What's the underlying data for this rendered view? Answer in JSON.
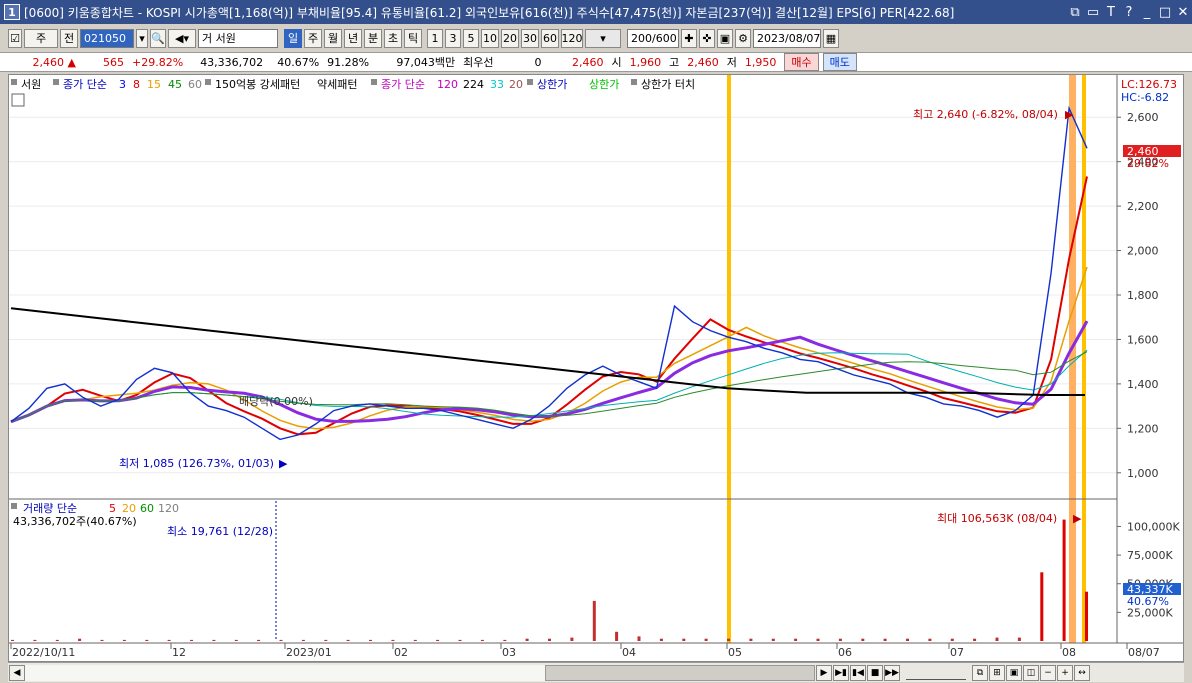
{
  "window": {
    "number": "1",
    "title": "[0600] 키움종합차트 - KOSPI 시가총액[1,168(억)] 부채비율[95.4] 유통비율[61.2] 외국인보유[616(천)] 주식수[47,475(천)] 자본금[237(억)] 결산[12월] EPS[6] PER[422.68]"
  },
  "toolbar": {
    "period_type": "주",
    "market": "전",
    "code": "021050",
    "name_prefix": "거",
    "name": "서원",
    "intervals": [
      "일",
      "주",
      "월",
      "년",
      "분",
      "초",
      "틱"
    ],
    "selected_interval": "일",
    "minutes": [
      "1",
      "3",
      "5",
      "10",
      "20",
      "30",
      "60",
      "120"
    ],
    "count": "200/600",
    "date": "2023/08/07"
  },
  "quote": {
    "price": "2,460",
    "change": "565",
    "change_rate": "+29.82%",
    "volume": "43,336,702",
    "volume_rate": "40.67%",
    "ratio": "91.28%",
    "amount": "97,043백만",
    "preferred_label": "최우선",
    "preferred_value": "0",
    "ask": "2,460",
    "open_label": "시",
    "open": "1,960",
    "high_label": "고",
    "high": "2,460",
    "low_label": "저",
    "low": "1,950",
    "buy_label": "매수",
    "sell_label": "매도"
  },
  "legend": {
    "stock": "서원",
    "ma_label": "종가 단순",
    "ma_periods": [
      "3",
      "8",
      "15",
      "45",
      "60"
    ],
    "ma_colors": [
      "#0000ff",
      "#e00000",
      "#e8a000",
      "#009000",
      "#808080"
    ],
    "pattern1": "150억봉 강세패턴",
    "pattern2": "약세패턴",
    "ma2_label": "종가 단순",
    "ma2_periods": [
      "120",
      "224",
      "33",
      "20"
    ],
    "upper_limit": "상한가",
    "upper_limit2": "상한가",
    "upper_touch": "상한가 터치"
  },
  "chart_data": {
    "type": "line",
    "title": "",
    "price_axis": [
      "2,600",
      "2,400",
      "2,200",
      "2,000",
      "1,800",
      "1,600",
      "1,400",
      "1,200",
      "1,000"
    ],
    "volume_axis": [
      "100,000K",
      "75,000K",
      "50,000K",
      "25,000K"
    ],
    "x_labels": [
      "2022/10/11",
      "12",
      "2023/01",
      "02",
      "03",
      "04",
      "05",
      "06",
      "07",
      "08",
      "08/07"
    ],
    "lc": "LC:126.73",
    "hc": "HC:-6.82",
    "current_price": "2,460",
    "current_rate": "29.82%",
    "current_volume": "43,337K",
    "current_volume_rate": "40.67%",
    "high_annotation": "최고 2,640 (-6.82%, 08/04)",
    "low_annotation": "최저 1,085 (126.73%, 01/03)",
    "dividend_annotation": "배당락(0.00%)",
    "volume_legend": "거래량 단순",
    "volume_ma": [
      "5",
      "20",
      "60",
      "120"
    ],
    "volume_current": "43,336,702주(40.67%)",
    "volume_min": "최소 19,761 (12/28)",
    "volume_max": "최대 106,563K (08/04)",
    "ylim": [
      900,
      2700
    ],
    "close_series": [
      1230,
      1290,
      1380,
      1400,
      1340,
      1300,
      1330,
      1420,
      1470,
      1450,
      1360,
      1300,
      1280,
      1250,
      1200,
      1150,
      1170,
      1220,
      1280,
      1300,
      1310,
      1300,
      1290,
      1290,
      1280,
      1260,
      1240,
      1220,
      1200,
      1240,
      1300,
      1380,
      1440,
      1480,
      1440,
      1410,
      1380,
      1750,
      1680,
      1640,
      1610,
      1590,
      1560,
      1540,
      1510,
      1500,
      1470,
      1440,
      1420,
      1400,
      1360,
      1340,
      1310,
      1300,
      1280,
      1250,
      1280,
      1350,
      1900,
      2640,
      2460
    ],
    "ma_slow_series": [
      1740,
      1720,
      1700,
      1680,
      1660,
      1640,
      1620,
      1600,
      1580,
      1560,
      1540,
      1520,
      1500,
      1480,
      1460,
      1440,
      1420,
      1400,
      1380,
      1370,
      1360,
      1360,
      1360,
      1360,
      1360,
      1355,
      1350,
      1350
    ],
    "volume_series": [
      1,
      1,
      1,
      2,
      1,
      1,
      1,
      1,
      1,
      1,
      1,
      1,
      1,
      1,
      1,
      1,
      1,
      1,
      1,
      1,
      1,
      1,
      1,
      2,
      2,
      3,
      35,
      8,
      4,
      2,
      2,
      2,
      2,
      2,
      2,
      2,
      2,
      2,
      2,
      2,
      2,
      2,
      2,
      2,
      3,
      3,
      60,
      106,
      43
    ]
  },
  "scrollbar": {
    "left": "◀",
    "right": "▶"
  }
}
